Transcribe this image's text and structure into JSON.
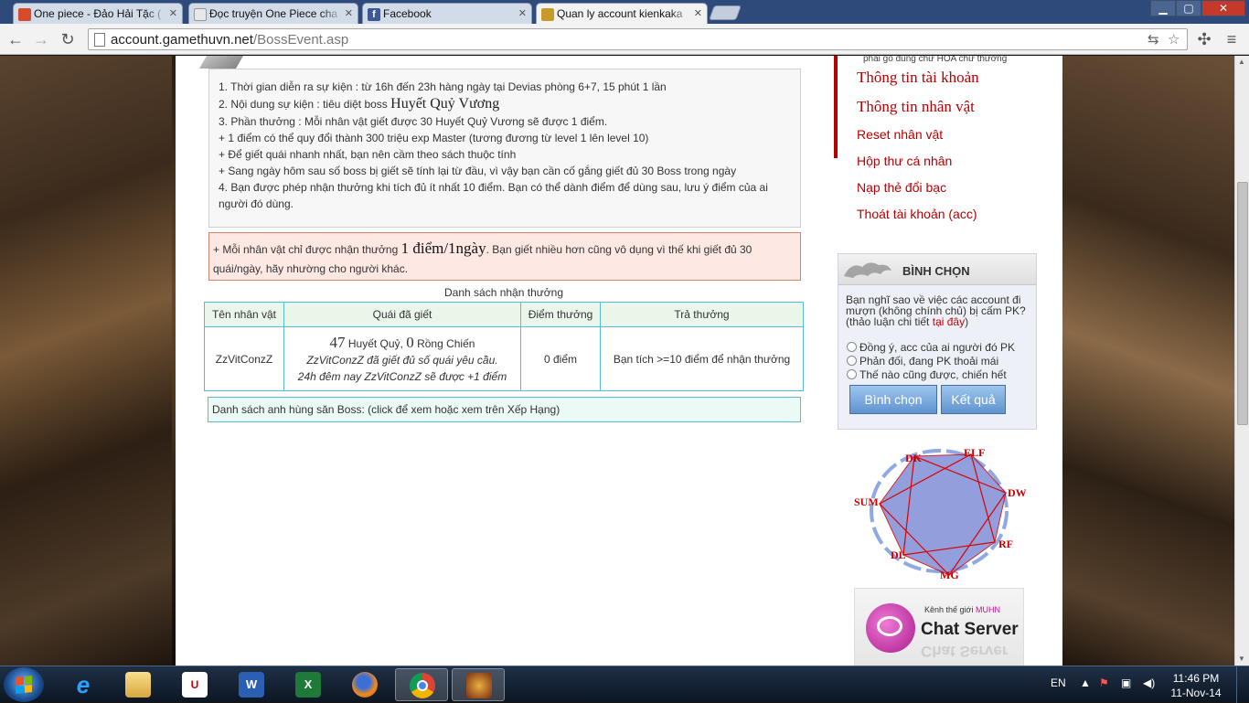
{
  "browser": {
    "tabs": [
      {
        "label": "One piece - Đảo Hải Tặc (",
        "favicon_color": "#d84a2a"
      },
      {
        "label": "Đọc truyện One Piece cha",
        "favicon_color": "#e8e8e8"
      },
      {
        "label": "Facebook",
        "favicon_color": "#3b5998"
      },
      {
        "label": "Quan ly account kienkaka",
        "favicon_color": "#c89a2a"
      }
    ],
    "window_controls": {
      "minimize": "▁",
      "maximize": "▢",
      "close": "✕"
    },
    "url_host": "account.gamethuvn.net",
    "url_path": "/BossEvent.asp"
  },
  "event_rules": [
    "1. Thời gian diễn ra sự kiện : từ 16h đến 23h hàng ngày tại Devias phòng 6+7, 15 phút 1 lần",
    "3. Phần thưởng : Mỗi nhân vật giết được 30 Huyết Quỷ Vương sẽ được 1 điểm.",
    "+ 1 điểm có thể quy đổi thành 300 triệu exp Master (tương đương từ level 1 lên level 10)",
    "+ Để giết quái nhanh nhất, bạn nên cầm theo sách thuộc tính",
    "+ Sang ngày hôm sau số boss bị giết sẽ tính lại từ đầu, vì vậy bạn cần cố gắng giết đủ 30 Boss trong ngày",
    "4. Bạn được phép nhận thưởng khi tích đủ ít nhất 10 điểm. Bạn có thể dành điểm để dùng sau, lưu ý điểm của ai người đó dùng."
  ],
  "rule2_prefix": "2. Nội dung sự kiện : tiêu diệt boss ",
  "rule2_boss": "Huyết Quỷ Vương",
  "note": {
    "prefix": "+ Mỗi nhân vật chỉ được nhận thưởng ",
    "highlight": "1 điểm/1ngày",
    "suffix": ". Bạn giết nhiều hơn cũng vô dụng vì thế khi giết đủ 30 quái/ngày, hãy nhường cho người khác."
  },
  "rewards_table": {
    "caption": "Danh sách nhận thưởng",
    "headers": [
      "Tên nhân vật",
      "Quái đã giết",
      "Điểm thưởng",
      "Trả thưởng"
    ],
    "row": {
      "name": "ZzVitConzZ",
      "kills_huyet": "47",
      "kills_huyet_label": " Huyết Quỷ, ",
      "kills_rong": "0",
      "kills_rong_label": " Rồng Chiến",
      "kills_note1": "ZzVitConzZ đã giết đủ số quái yêu cầu.",
      "kills_note2": "24h đêm nay ZzVitConzZ sẽ được +1 điểm",
      "points": "0 điểm",
      "payout": "Bạn tích >=10 điểm để nhận thưởng"
    }
  },
  "heroes_link": "Danh sách anh hùng săn Boss: (click để xem hoặc xem trên Xếp Hạng)",
  "sidebar": {
    "top_small": "phải gõ đúng chữ HOA chữ thường",
    "menu_big": [
      "Thông tin tài khoản",
      "Thông tin nhân vật"
    ],
    "menu_small": [
      "Reset nhân vật",
      "Hộp thư cá nhân",
      "Nạp thẻ đổi bạc",
      "Thoát tài khoản (acc)"
    ],
    "poll": {
      "title": "BÌNH CHỌN",
      "question": "Bạn nghĩ sao về việc các account đi mượn (không chính chủ) bị cấm PK? (thảo luận chi tiết ",
      "question_link": "tại đây",
      "question_end": ")",
      "options": [
        "Đồng ý, acc của ai người đó PK",
        "Phản đối, đang PK thoải mái",
        "Thế nào cũng được, chiến hết"
      ],
      "vote_button": "Bình chọn",
      "result_button": "Kết quả"
    },
    "class_wheel": [
      "DK",
      "ELF",
      "DW",
      "RF",
      "MG",
      "DL",
      "SUM"
    ],
    "chat": {
      "kenh": "Kênh thế giới ",
      "muhn": "MUHN",
      "title": "Chat Server"
    }
  },
  "taskbar": {
    "lang": "EN",
    "time": "11:46 PM",
    "date": "11-Nov-14"
  }
}
